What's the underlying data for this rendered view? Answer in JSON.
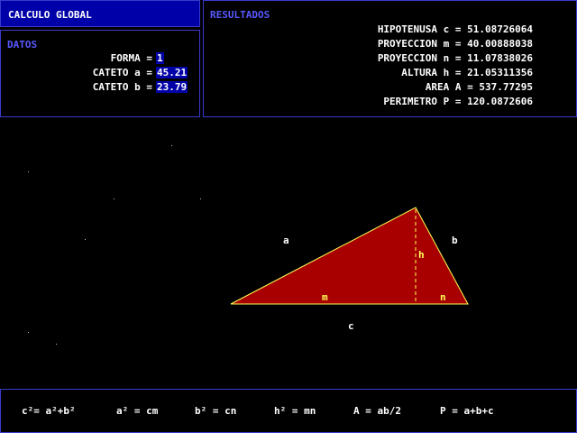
{
  "title": "CALCULO GLOBAL",
  "datos": {
    "label": "DATOS",
    "fields": [
      {
        "label": "FORMA =",
        "value": "1"
      },
      {
        "label": "CATETO a =",
        "value": "45.21"
      },
      {
        "label": "CATETO b =",
        "value": "23.79"
      }
    ]
  },
  "resultados": {
    "label": "RESULTADOS",
    "lines": [
      "HIPOTENUSA c = 51.08726064",
      "PROYECCION m = 40.00888038",
      "PROYECCION n = 11.07838026",
      "ALTURA h = 21.05311356",
      "AREA A = 537.77295",
      "PERIMETRO P = 120.0872606"
    ]
  },
  "diagram": {
    "side_a": "a",
    "side_b": "b",
    "side_c": "c",
    "height": "h",
    "proj_m": "m",
    "proj_n": "n",
    "fill_color": "#a80000",
    "line_color": "#ffff55"
  },
  "formulas": [
    "c²= a²+b²",
    "a² = cm",
    "b² = cn",
    "h² = mn",
    "A = ab/2",
    "P = a+b+c"
  ]
}
